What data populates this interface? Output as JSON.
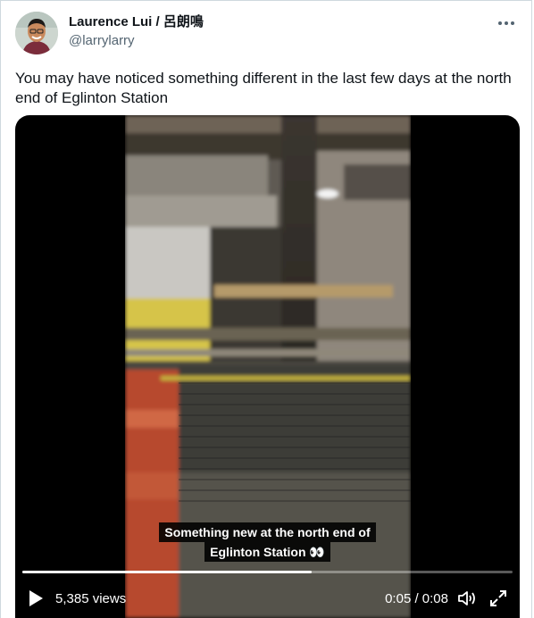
{
  "author": {
    "display_name": "Laurence Lui / 呂朗鳴",
    "handle": "@larrylarry"
  },
  "tweet": {
    "text": "You may have noticed something different in the last few days at the north end of Eglinton Station"
  },
  "video": {
    "caption_line1": "Something new at the north end of",
    "caption_line2": "Eglinton Station 👀",
    "views": "5,385 views",
    "time": "0:05 / 0:08",
    "progress_fraction": 0.59
  },
  "icons": {
    "more": "more-horizontal-icon",
    "play": "play-icon",
    "volume": "volume-icon",
    "fullscreen": "fullscreen-icon"
  },
  "colors": {
    "text_primary": "#0f1419",
    "text_secondary": "#536471",
    "border": "#cfd9de"
  }
}
